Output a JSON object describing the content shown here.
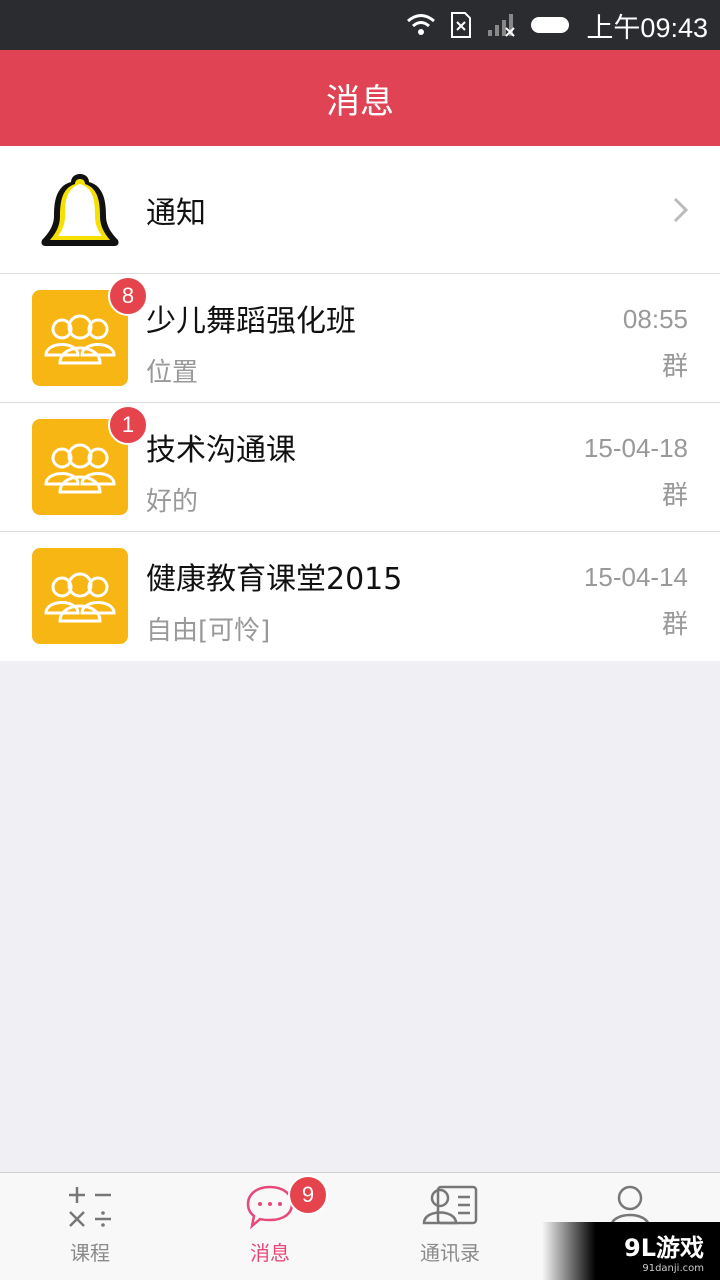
{
  "status_bar": {
    "time": "上午09:43",
    "icons": [
      "wifi-icon",
      "sim-missing-icon",
      "signal-icon",
      "battery-icon"
    ]
  },
  "header": {
    "title": "消息"
  },
  "notification": {
    "label": "通知",
    "icon": "bell-icon"
  },
  "conversations": [
    {
      "name": "少儿舞蹈强化班",
      "last_message": "位置",
      "time": "08:55",
      "type": "群",
      "unread": "8"
    },
    {
      "name": "技术沟通课",
      "last_message": "好的",
      "time": "15-04-18",
      "type": "群",
      "unread": "1"
    },
    {
      "name": "健康教育课堂2015",
      "last_message": "自由[可怜]",
      "time": "15-04-14",
      "type": "群",
      "unread": ""
    }
  ],
  "tabs": [
    {
      "label": "课程",
      "icon": "math-symbols-icon"
    },
    {
      "label": "消息",
      "icon": "chat-bubble-icon",
      "badge": "9"
    },
    {
      "label": "通讯录",
      "icon": "contacts-card-icon"
    },
    {
      "label": "",
      "icon": "person-icon"
    }
  ],
  "watermark": {
    "logo": "9L游戏",
    "url": "91danji.com"
  },
  "colors": {
    "header": "#e04454",
    "accent_pink": "#e8497a",
    "avatar": "#f8b614",
    "badge": "#e6444c"
  }
}
